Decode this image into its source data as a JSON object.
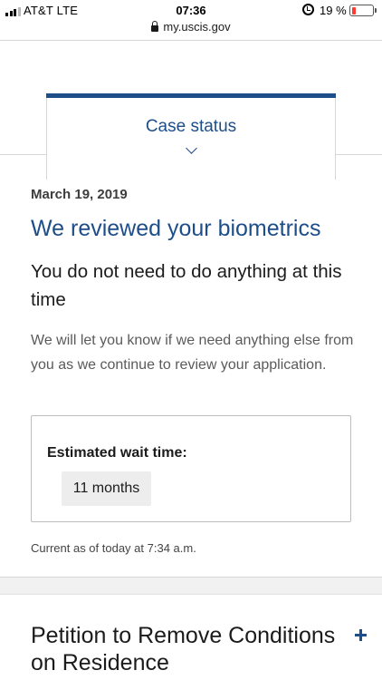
{
  "status_bar": {
    "carrier": "AT&T  LTE",
    "time": "07:36",
    "battery_percent": "19 %",
    "battery_level": 0.19,
    "battery_color": "#ff3b30"
  },
  "browser": {
    "url": "my.uscis.gov"
  },
  "case_status_tab": {
    "label": "Case status",
    "icon": "chevron-down-icon"
  },
  "status": {
    "date": "March 19, 2019",
    "title": "We reviewed your biometrics",
    "action": "You do not need to do anything at this time",
    "description": "We will let you know if we need anything else from you as we continue to review your application.",
    "wait_time_label": "Estimated wait time:",
    "wait_time_value": "11 months",
    "updated": "Current as of today at 7:34 a.m."
  },
  "next_case": {
    "title": "Petition to Remove Conditions on Residence",
    "icon": "plus-icon"
  },
  "colors": {
    "brand_blue": "#1d4e89",
    "chip_gray": "#ededed",
    "border_gray": "#d6d6d6"
  }
}
